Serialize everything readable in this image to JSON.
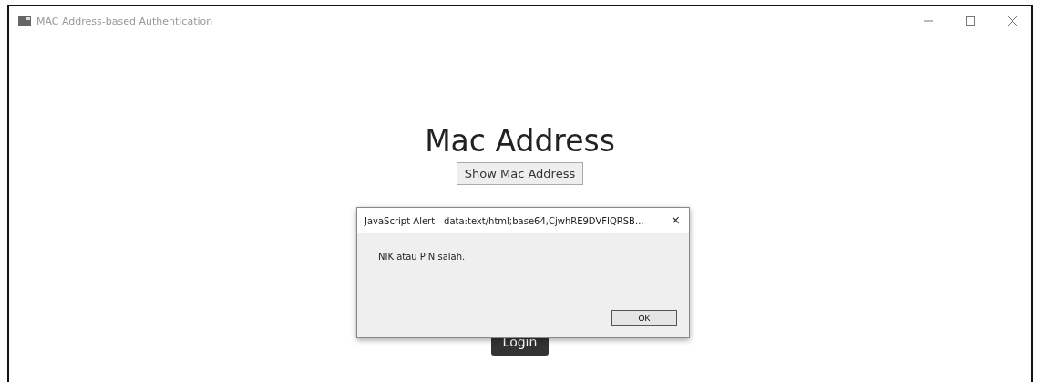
{
  "window": {
    "title": "MAC Address-based Authentication"
  },
  "page": {
    "heading": "Mac Address",
    "show_button": "Show Mac Address",
    "login_button": "Login"
  },
  "alert": {
    "title": "JavaScript Alert - data:text/html;base64,CjwhRE9DVFIQRSB...",
    "close": "×",
    "message": "NIK atau PIN salah.",
    "ok": "OK"
  }
}
